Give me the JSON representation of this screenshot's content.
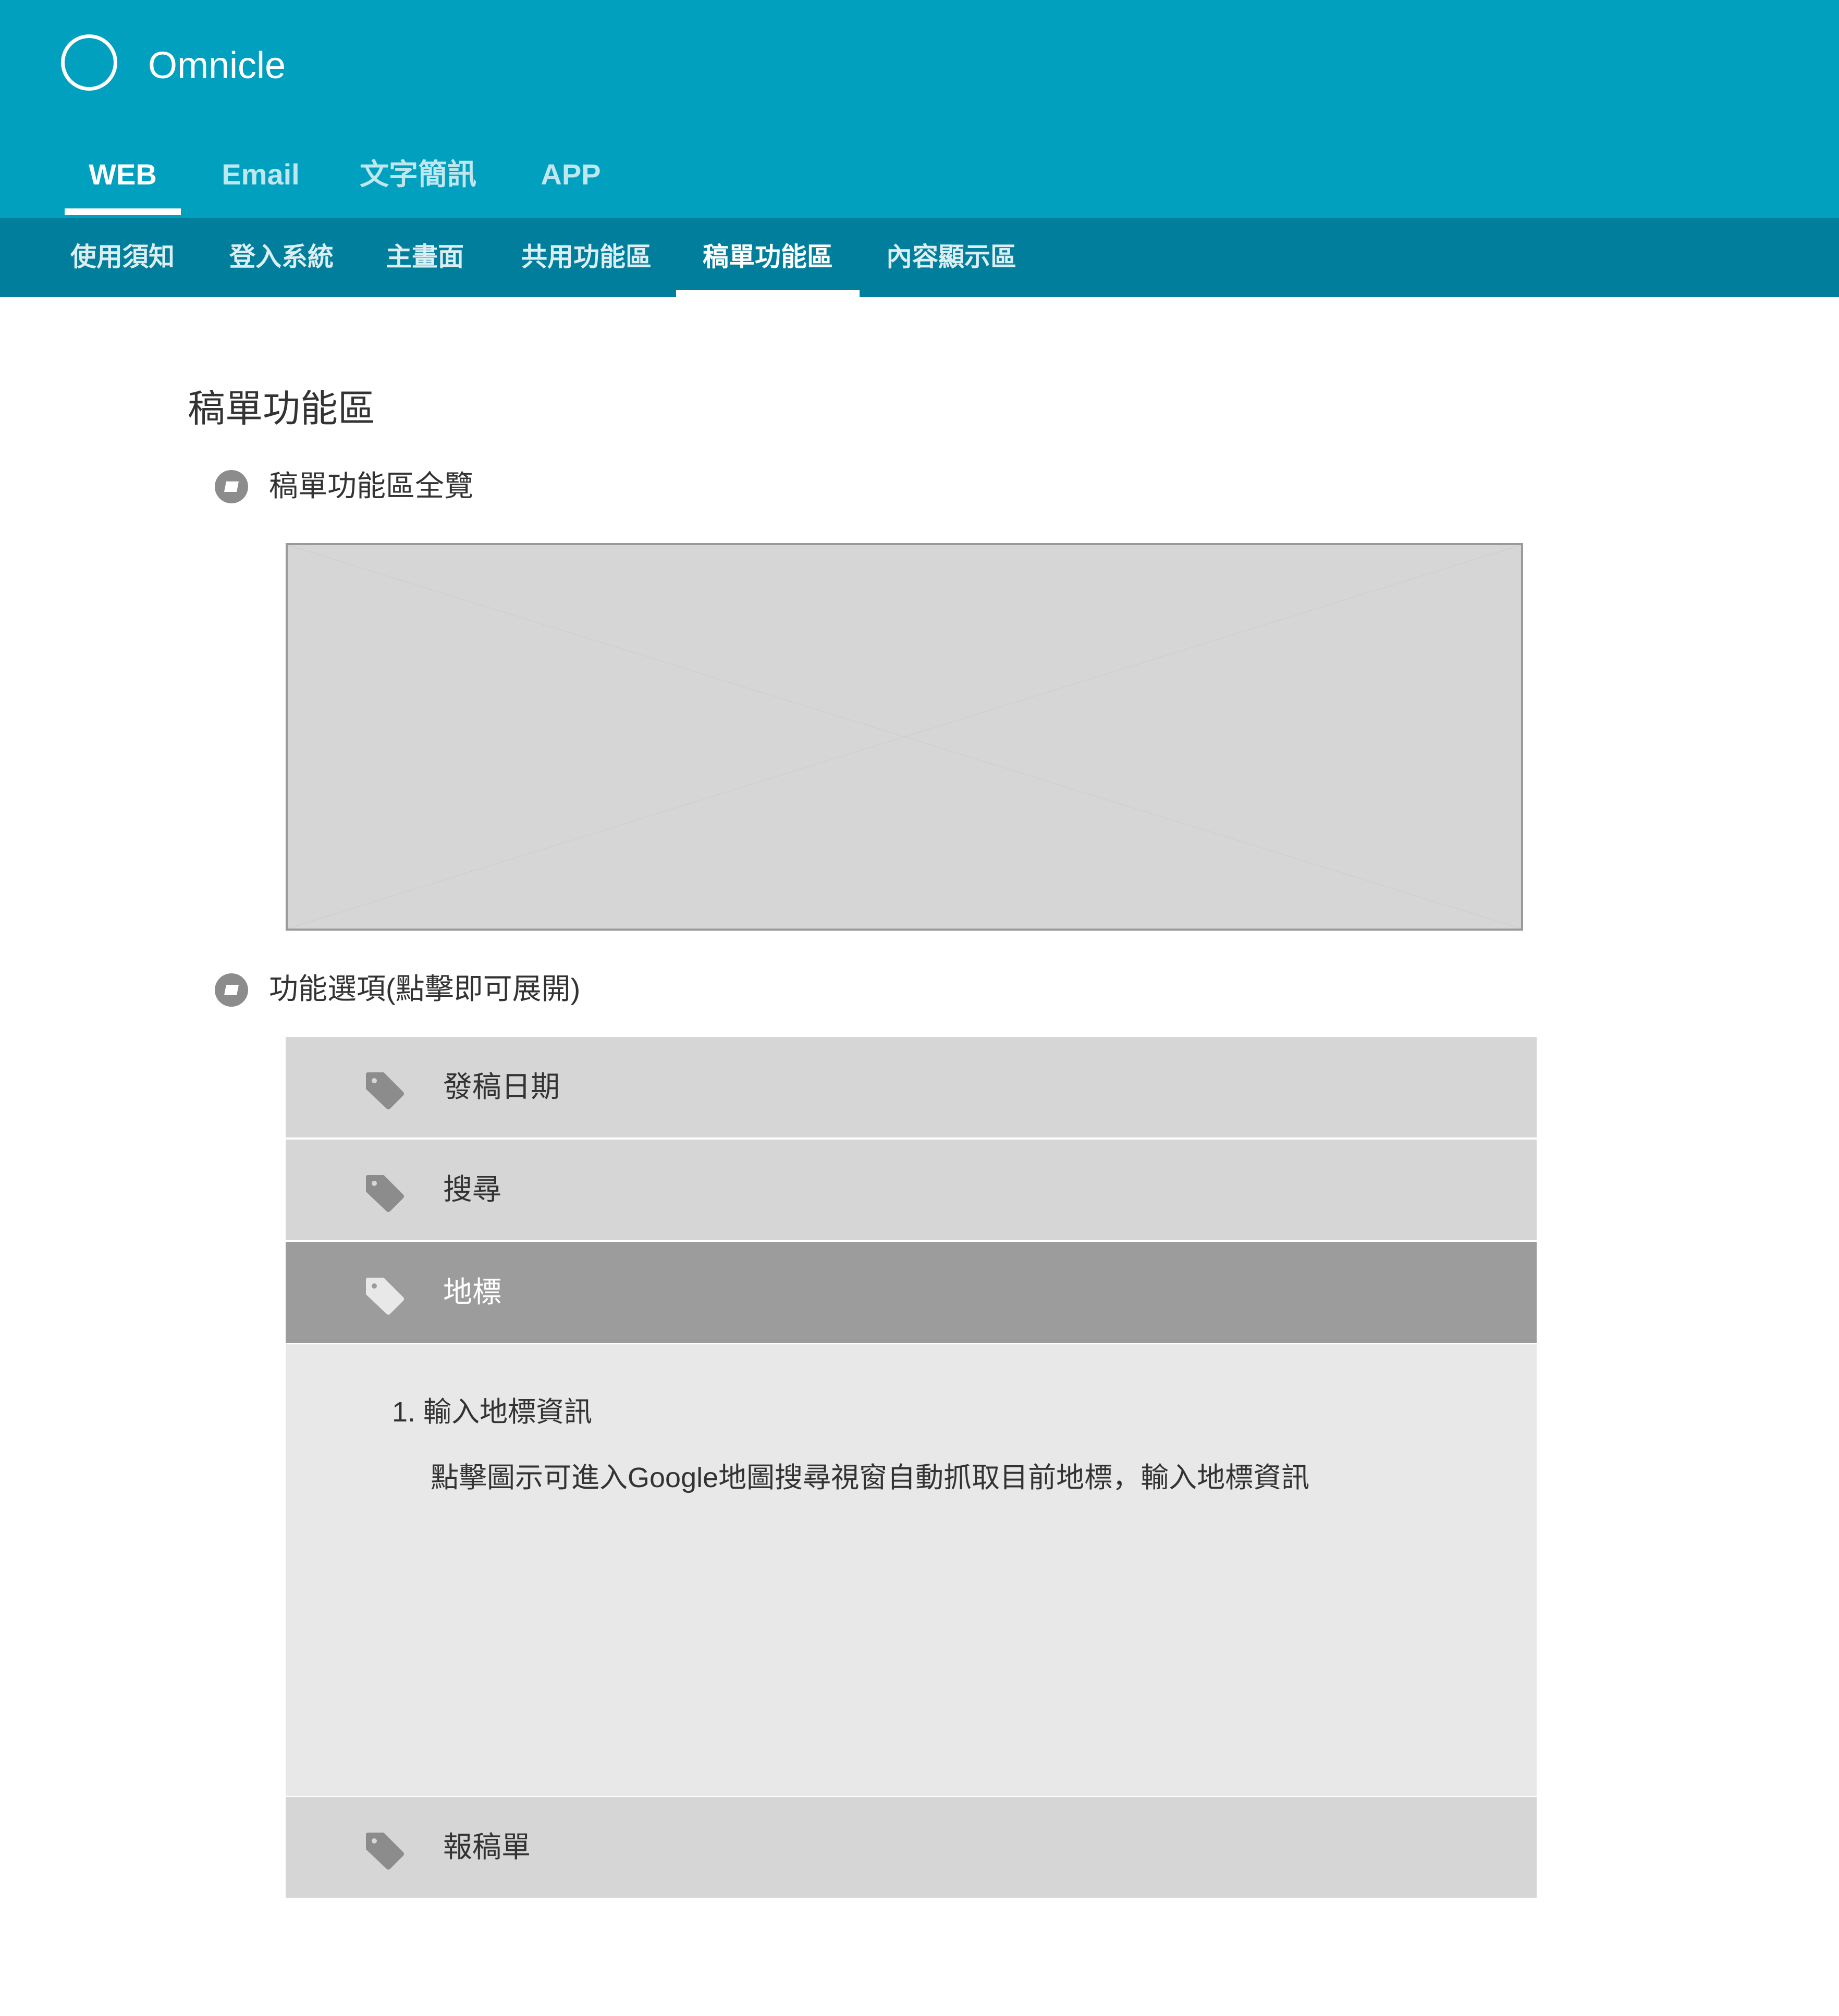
{
  "app": {
    "name": "Omnicle"
  },
  "main_tabs": [
    {
      "label": "WEB",
      "active": true
    },
    {
      "label": "Email",
      "active": false
    },
    {
      "label": "文字簡訊",
      "active": false
    },
    {
      "label": "APP",
      "active": false
    }
  ],
  "sub_tabs": [
    {
      "label": "使用須知",
      "active": false
    },
    {
      "label": "登入系統",
      "active": false
    },
    {
      "label": "主畫面",
      "active": false
    },
    {
      "label": "共用功能區",
      "active": false
    },
    {
      "label": "稿單功能區",
      "active": true
    },
    {
      "label": "內容顯示區",
      "active": false
    }
  ],
  "page": {
    "title": "稿單功能區",
    "overview_label": "稿單功能區全覽",
    "options_label": "功能選項(點擊即可展開)"
  },
  "accordion": {
    "items": [
      {
        "label": "發稿日期",
        "expanded": false
      },
      {
        "label": "搜尋",
        "expanded": false
      },
      {
        "label": "地標",
        "expanded": true
      },
      {
        "label": "報稿單",
        "expanded": false
      }
    ],
    "expanded_detail": {
      "title": "1. 輸入地標資訊",
      "description": "點擊圖示可進入Google地圖搜尋視窗自動抓取目前地標，輸入地標資訊"
    }
  },
  "colors": {
    "header": "#02a0bf",
    "subnav": "#007e9b",
    "accordion_row": "#d6d6d6",
    "accordion_row_active": "#9c9c9c",
    "accordion_panel": "#e8e8e8",
    "icon_gray": "#8c8c8c"
  },
  "icons": {
    "logo": "circle-logo-icon",
    "section_bullet": "disc-bullet-icon",
    "accordion_item": "tag-icon"
  }
}
